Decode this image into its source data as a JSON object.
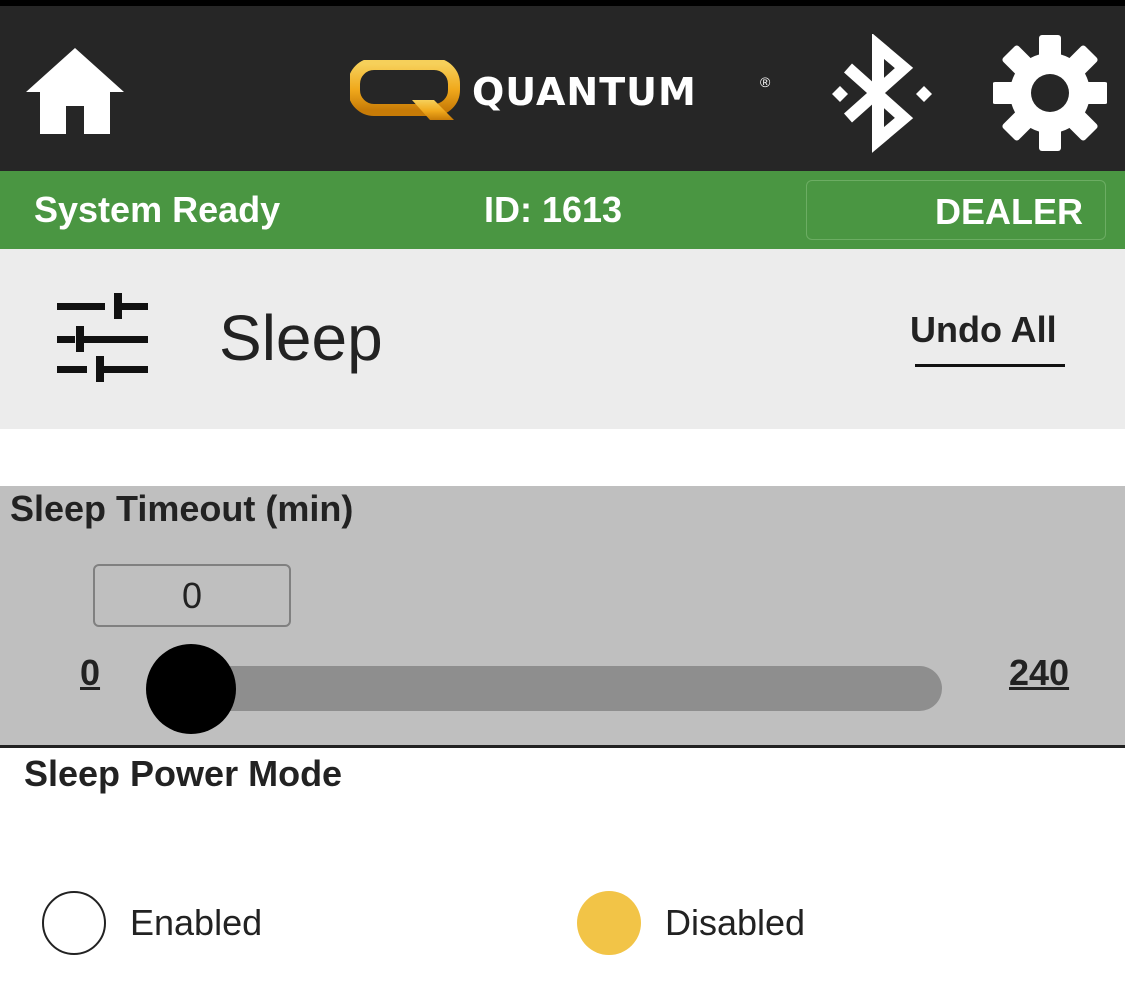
{
  "header": {
    "brand_name": "QUANTUM",
    "icons": [
      "home-icon",
      "bluetooth-icon",
      "gear-icon"
    ]
  },
  "status_bar": {
    "status": "System Ready",
    "id_text": "ID: 1613",
    "role_label": "DEALER",
    "color": "#4a9642"
  },
  "page": {
    "title": "Sleep",
    "icon": "sliders-icon",
    "undo_label": "Undo All"
  },
  "sleep_timeout": {
    "label": "Sleep Timeout (min)",
    "value": "0",
    "min": "0",
    "max": "240",
    "level": 0
  },
  "sleep_power_mode": {
    "label": "Sleep Power Mode",
    "options": [
      {
        "label": "Enabled",
        "selected": false
      },
      {
        "label": "Disabled",
        "selected": true
      }
    ],
    "selected_color": "#f2c447"
  }
}
